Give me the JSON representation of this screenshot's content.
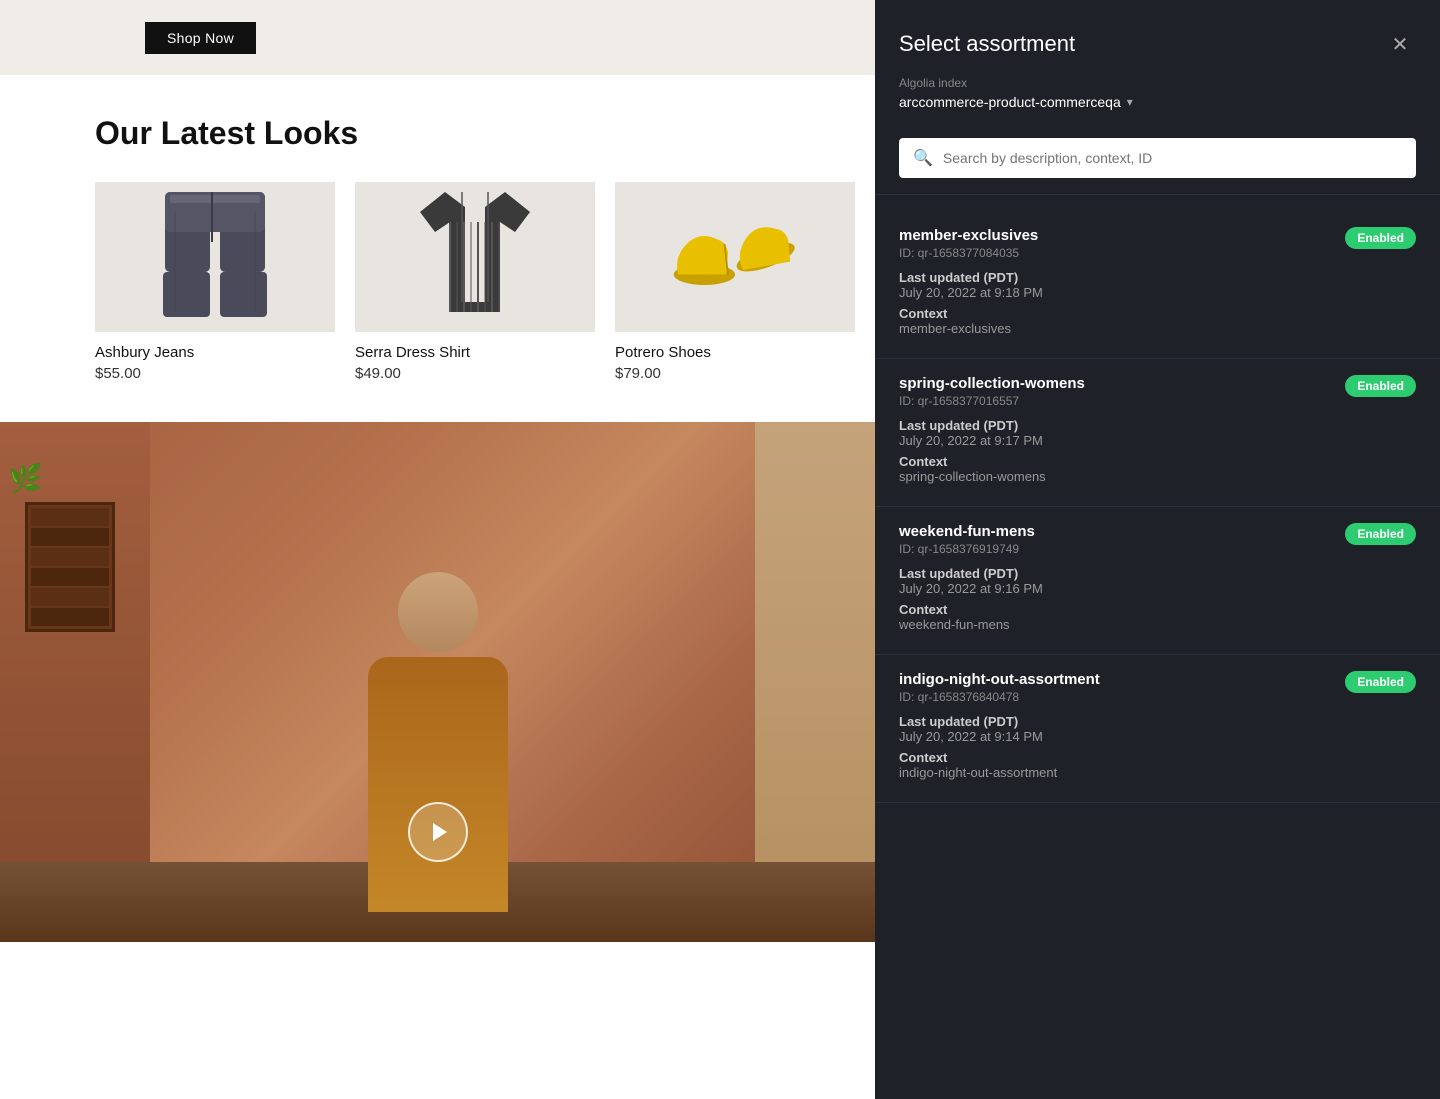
{
  "hero": {
    "shop_now_label": "Shop Now"
  },
  "latest_looks": {
    "heading": "Our Latest Looks",
    "products": [
      {
        "name": "Ashbury Jeans",
        "price": "$55.00"
      },
      {
        "name": "Serra Dress Shirt",
        "price": "$49.00"
      },
      {
        "name": "Potrero Shoes",
        "price": "$79.00"
      }
    ]
  },
  "panel": {
    "title": "Select assortment",
    "close_label": "✕",
    "algolia_label": "Algolia index",
    "algolia_value": "arccommerce-product-commerceqa",
    "search_placeholder": "Search by description, context, ID",
    "assortments": [
      {
        "name": "member-exclusives",
        "id": "ID: qr-1658377084035",
        "status": "Enabled",
        "last_updated_label": "Last updated (PDT)",
        "last_updated": "July 20, 2022 at 9:18 PM",
        "context_label": "Context",
        "context": "member-exclusives"
      },
      {
        "name": "spring-collection-womens",
        "id": "ID: qr-1658377016557",
        "status": "Enabled",
        "last_updated_label": "Last updated (PDT)",
        "last_updated": "July 20, 2022 at 9:17 PM",
        "context_label": "Context",
        "context": "spring-collection-womens"
      },
      {
        "name": "weekend-fun-mens",
        "id": "ID: qr-1658376919749",
        "status": "Enabled",
        "last_updated_label": "Last updated (PDT)",
        "last_updated": "July 20, 2022 at 9:16 PM",
        "context_label": "Context",
        "context": "weekend-fun-mens"
      },
      {
        "name": "indigo-night-out-assortment",
        "id": "ID: qr-1658376840478",
        "status": "Enabled",
        "last_updated_label": "Last updated (PDT)",
        "last_updated": "July 20, 2022 at 9:14 PM",
        "context_label": "Context",
        "context": "indigo-night-out-assortment"
      }
    ]
  }
}
